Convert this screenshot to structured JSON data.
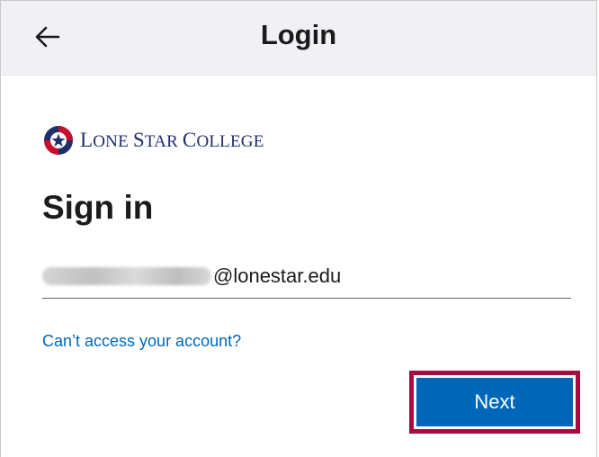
{
  "header": {
    "title": "Login",
    "back_icon": "arrow-left-icon"
  },
  "logo": {
    "parts": [
      "L",
      "ONE ",
      "S",
      "TAR ",
      "C",
      "OLLEGE"
    ],
    "colors": {
      "navy": "#1f2f6b",
      "red": "#c8102e",
      "white": "#ffffff"
    }
  },
  "main": {
    "title": "Sign in",
    "email": {
      "domain": "@lonestar.edu",
      "username_redacted": true
    },
    "cant_access_link": "Can’t access your account?",
    "next_button": "Next"
  },
  "colors": {
    "accent": "#0067b8",
    "highlight": "#a50d3f",
    "topbar": "#f0f0f5"
  }
}
